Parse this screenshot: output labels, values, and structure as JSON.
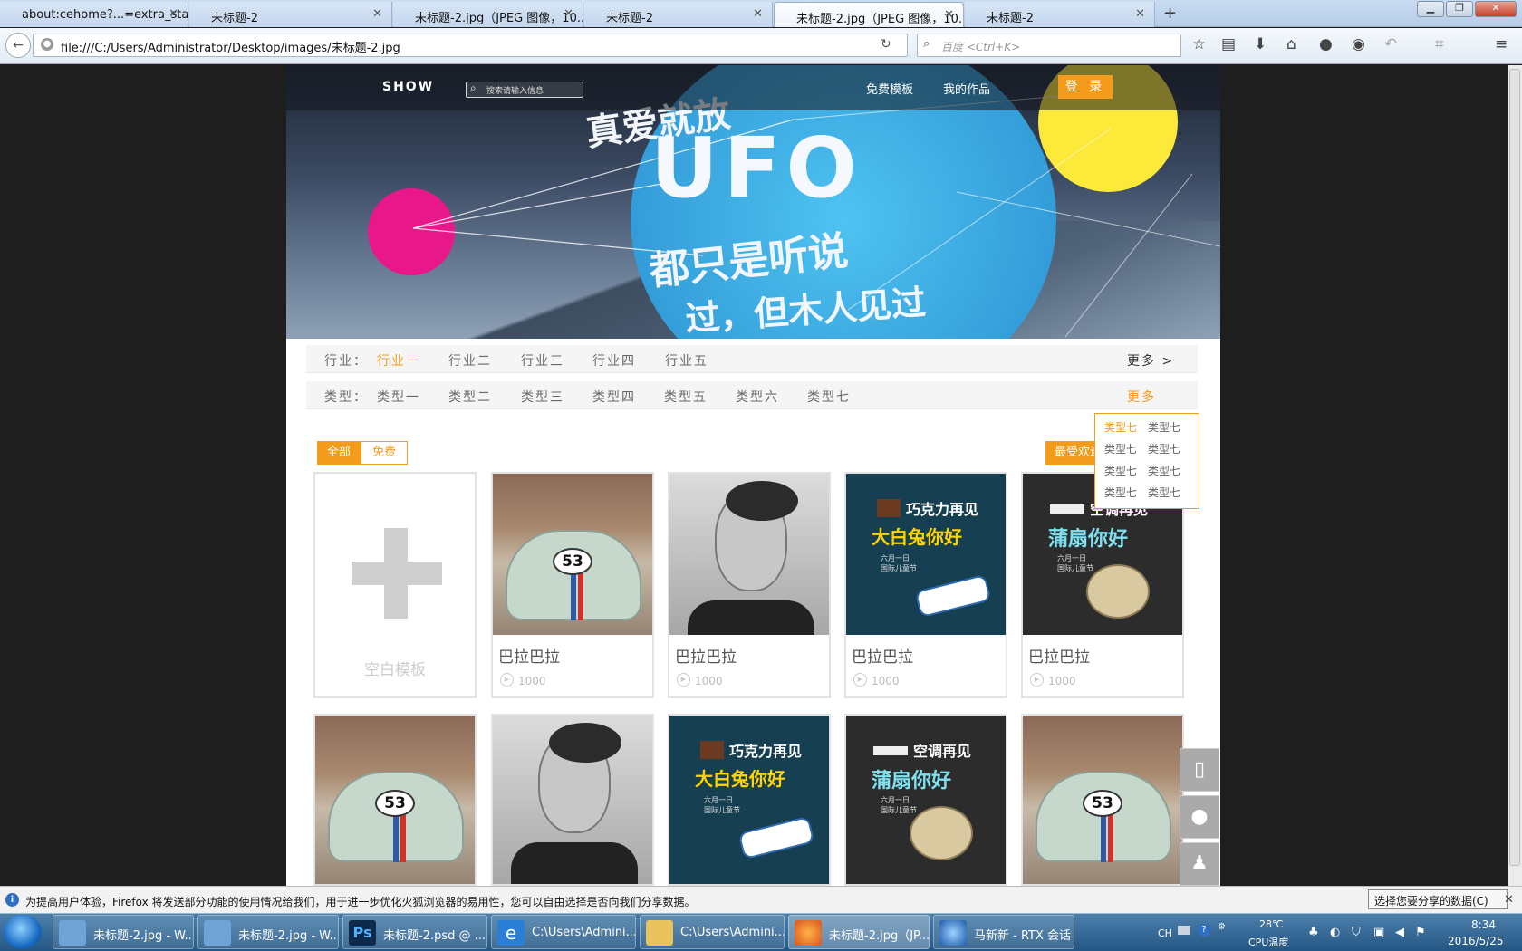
{
  "browser": {
    "tabs": [
      {
        "title": "about:cehome?...=extra_start"
      },
      {
        "title": "未标题-2"
      },
      {
        "title": "未标题-2.jpg（JPEG 图像，10..."
      },
      {
        "title": "未标题-2"
      },
      {
        "title": "未标题-2.jpg（JPEG 图像，10..."
      },
      {
        "title": "未标题-2"
      }
    ],
    "url": "file:///C:/Users/Administrator/Desktop/images/未标题-2.jpg",
    "search_placeholder": "百度 <Ctrl+K>"
  },
  "site": {
    "logo": "SHOW",
    "search_placeholder": "搜索请输入信息",
    "nav": [
      "免费模板",
      "我的作品"
    ],
    "login": "登 录",
    "hero": {
      "line1": "真爱就放",
      "main": "UFO",
      "line2": "都只是听说",
      "line3": "过，但木人见过"
    }
  },
  "filters": {
    "industry": {
      "label": "行业：",
      "options": [
        "行业一",
        "行业二",
        "行业三",
        "行业四",
        "行业五"
      ],
      "selected": "行业一",
      "more": "更多 >"
    },
    "type": {
      "label": "类型：",
      "options": [
        "类型一",
        "类型二",
        "类型三",
        "类型四",
        "类型五",
        "类型六",
        "类型七"
      ],
      "more": "更多"
    },
    "dropdown": [
      "类型七",
      "类型七",
      "类型七",
      "类型七",
      "类型七",
      "类型七",
      "类型七",
      "类型七"
    ]
  },
  "toggles": {
    "all": "全部",
    "free": "免费",
    "sort": "最受欢迎"
  },
  "cards": {
    "blank_label": "空白模板",
    "row1": [
      {
        "title": "巴拉巴拉",
        "count": "1000"
      },
      {
        "title": "巴拉巴拉",
        "count": "1000"
      },
      {
        "title": "巴拉巴拉",
        "count": "1000"
      },
      {
        "title": "巴拉巴拉",
        "count": "1000"
      }
    ],
    "poster1": {
      "l1": "巧克力再见",
      "l2": "大白兔你好",
      "l3a": "六月一日",
      "l3b": "国际儿童节"
    },
    "poster2": {
      "l1": "空调再见",
      "l2": "蒲扇你好",
      "l3a": "六月一日",
      "l3b": "国际儿童节"
    },
    "car_number": "53"
  },
  "notification": {
    "message": "为提高用户体验，Firefox 将发送部分功能的使用情况给我们，用于进一步优化火狐浏览器的易用性，您可以自由选择是否向我们分享数据。",
    "button": "选择您要分享的数据(C)"
  },
  "taskbar": {
    "items": [
      {
        "label": "未标题-2.jpg - W..."
      },
      {
        "label": "未标题-2.jpg - W..."
      },
      {
        "label": "未标题-2.psd @ ..."
      },
      {
        "label": "C:\\Users\\Admini..."
      },
      {
        "label": "C:\\Users\\Admini..."
      },
      {
        "label": "未标题-2.jpg（JP..."
      },
      {
        "label": "马新新 - RTX 会话"
      }
    ],
    "lang": "CH",
    "temp": "28℃",
    "temp_label": "CPU温度",
    "time": "8:34",
    "date": "2016/5/25"
  }
}
